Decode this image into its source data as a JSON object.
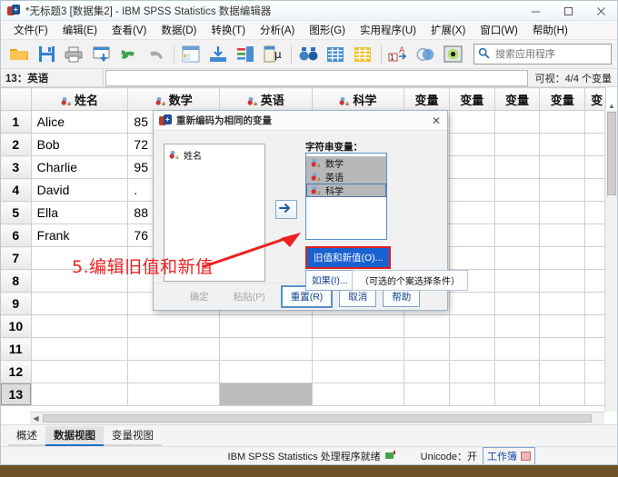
{
  "window": {
    "title": "*无标题3 [数据集2] - IBM SPSS Statistics 数据编辑器",
    "minimize_label": "—",
    "maximize_label": "☐",
    "close_label": "✕"
  },
  "menubar": {
    "items": [
      {
        "label": "文件(F)",
        "name": "menu-file"
      },
      {
        "label": "编辑(E)",
        "name": "menu-edit"
      },
      {
        "label": "查看(V)",
        "name": "menu-view"
      },
      {
        "label": "数据(D)",
        "name": "menu-data"
      },
      {
        "label": "转换(T)",
        "name": "menu-transform"
      },
      {
        "label": "分析(A)",
        "name": "menu-analyze"
      },
      {
        "label": "图形(G)",
        "name": "menu-graphs"
      },
      {
        "label": "实用程序(U)",
        "name": "menu-utilities"
      },
      {
        "label": "扩展(X)",
        "name": "menu-extensions"
      },
      {
        "label": "窗口(W)",
        "name": "menu-window"
      },
      {
        "label": "帮助(H)",
        "name": "menu-help"
      }
    ]
  },
  "toolbar": {
    "buttons": [
      {
        "name": "open-file-icon",
        "title": "打开"
      },
      {
        "name": "save-icon",
        "title": "保存"
      },
      {
        "name": "print-icon",
        "title": "打印"
      },
      {
        "name": "recall-dialog-icon",
        "title": "调用最近使用的对话框"
      },
      {
        "name": "undo-icon",
        "title": "撤消"
      },
      {
        "name": "redo-icon",
        "title": "重做"
      },
      {
        "name": "goto-case-icon",
        "title": "转至个案"
      },
      {
        "name": "goto-variable-icon",
        "title": "转至变量"
      },
      {
        "name": "variables-icon",
        "title": "变量"
      },
      {
        "name": "run-descriptives-icon",
        "title": "运行描述统计"
      },
      {
        "name": "find-icon",
        "title": "查找"
      },
      {
        "name": "insert-case-icon",
        "title": "插入个案"
      },
      {
        "name": "insert-variable-icon",
        "title": "插入变量"
      },
      {
        "name": "split-file-icon",
        "title": "拆分文件"
      },
      {
        "name": "weight-cases-icon",
        "title": "个案加权"
      },
      {
        "name": "select-cases-icon",
        "title": "选择个案"
      }
    ]
  },
  "search": {
    "placeholder": "搜索应用程序",
    "icon": "search-icon",
    "value": ""
  },
  "refbar": {
    "cell_ref": "13：英语",
    "cell_value": "",
    "visible_info": "可视：4/4 个变量"
  },
  "grid": {
    "columns": [
      "",
      "姓名",
      "数学",
      "英语",
      "科学",
      "变量",
      "变量",
      "变量",
      "变量",
      "变"
    ],
    "named_columns": [
      "姓名",
      "数学",
      "英语",
      "科学"
    ],
    "rows": [
      {
        "n": "1",
        "姓名": "Alice",
        "数学": "85",
        "英语": "",
        "科学": ""
      },
      {
        "n": "2",
        "姓名": "Bob",
        "数学": "72",
        "英语": "",
        "科学": ""
      },
      {
        "n": "3",
        "姓名": "Charlie",
        "数学": "95",
        "英语": "",
        "科学": ""
      },
      {
        "n": "4",
        "姓名": "David",
        "数学": ".",
        "英语": "",
        "科学": ""
      },
      {
        "n": "5",
        "姓名": "Ella",
        "数学": "88",
        "英语": "",
        "科学": ""
      },
      {
        "n": "6",
        "姓名": "Frank",
        "数学": "76",
        "英语": "",
        "科学": ""
      },
      {
        "n": "7",
        "姓名": "",
        "数学": "",
        "英语": "",
        "科学": ""
      },
      {
        "n": "8",
        "姓名": "",
        "数学": "",
        "英语": "",
        "科学": ""
      },
      {
        "n": "9",
        "姓名": "",
        "数学": "",
        "英语": "",
        "科学": ""
      },
      {
        "n": "10",
        "姓名": "",
        "数学": "",
        "英语": "",
        "科学": ""
      },
      {
        "n": "11",
        "姓名": "",
        "数学": "",
        "英语": "",
        "科学": ""
      },
      {
        "n": "12",
        "姓名": "",
        "数学": "",
        "英语": "",
        "科学": ""
      },
      {
        "n": "13",
        "姓名": "",
        "数学": "",
        "英语": "",
        "科学": ""
      }
    ],
    "selected_row": "13",
    "selected_column": "英语"
  },
  "dialog": {
    "title": "重新编码为相同的变量",
    "close_label": "✕",
    "source_variables": [
      {
        "label": "姓名",
        "selected": false
      }
    ],
    "target_label": "字符串变量：",
    "target_variables": [
      {
        "label": "数学",
        "selected": true
      },
      {
        "label": "英语",
        "selected": true
      },
      {
        "label": "科学",
        "selected": true,
        "focused": true
      }
    ],
    "move_arrow_icon": "arrow-right-icon",
    "old_new_button": "旧值和新值(O)...",
    "if_button": "如果(I)...",
    "if_hint": "（可选的个案选择条件）",
    "footer_buttons": [
      {
        "label": "确定",
        "name": "ok-button",
        "state": "disabled"
      },
      {
        "label": "粘贴(P)",
        "name": "paste-button",
        "state": "disabled"
      },
      {
        "label": "重置(R)",
        "name": "reset-button",
        "state": "default"
      },
      {
        "label": "取消",
        "name": "cancel-button",
        "state": "normal"
      },
      {
        "label": "帮助",
        "name": "help-button",
        "state": "normal"
      }
    ]
  },
  "annotation": {
    "text": "5.编辑旧值和新值",
    "color": "#ee2020",
    "arrow": "arrow-pointing-up-right"
  },
  "tabbar": {
    "tabs": [
      {
        "label": "概述",
        "name": "tab-overview",
        "active": false
      },
      {
        "label": "数据视图",
        "name": "tab-data-view",
        "active": true
      },
      {
        "label": "变量视图",
        "name": "tab-variable-view",
        "active": false
      }
    ]
  },
  "statusbar": {
    "processor": "IBM SPSS Statistics 处理程序就绪",
    "unicode": "Unicode：开",
    "workbook": "工作簿"
  }
}
